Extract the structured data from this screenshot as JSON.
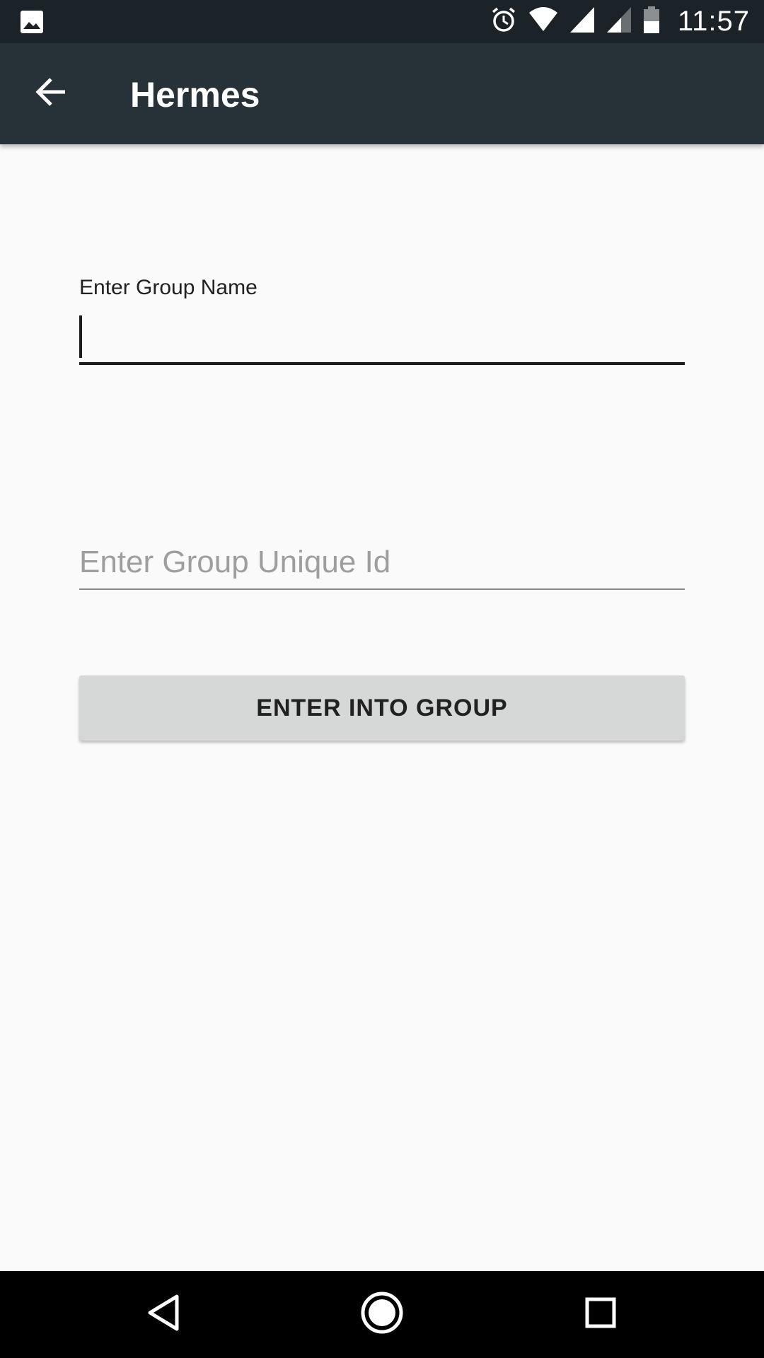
{
  "status_bar": {
    "time": "11:57",
    "icons": [
      "image-notification-icon",
      "alarm-icon",
      "wifi-icon",
      "cell-signal-icon",
      "cell-signal-secondary-icon",
      "battery-icon"
    ]
  },
  "app_bar": {
    "title": "Hermes",
    "back_icon": "arrow-back-icon"
  },
  "form": {
    "group_name_label": "Enter Group Name",
    "group_name_value": "",
    "group_id_placeholder": "Enter Group Unique Id",
    "group_id_value": "",
    "submit_label": "ENTER INTO GROUP"
  },
  "nav_bar": {
    "icons": [
      "nav-back-icon",
      "nav-home-icon",
      "nav-recents-icon"
    ]
  },
  "colors": {
    "status_bar": "#1c2328",
    "app_bar": "#263238",
    "background": "#fafafa",
    "button": "#d6d7d7"
  }
}
